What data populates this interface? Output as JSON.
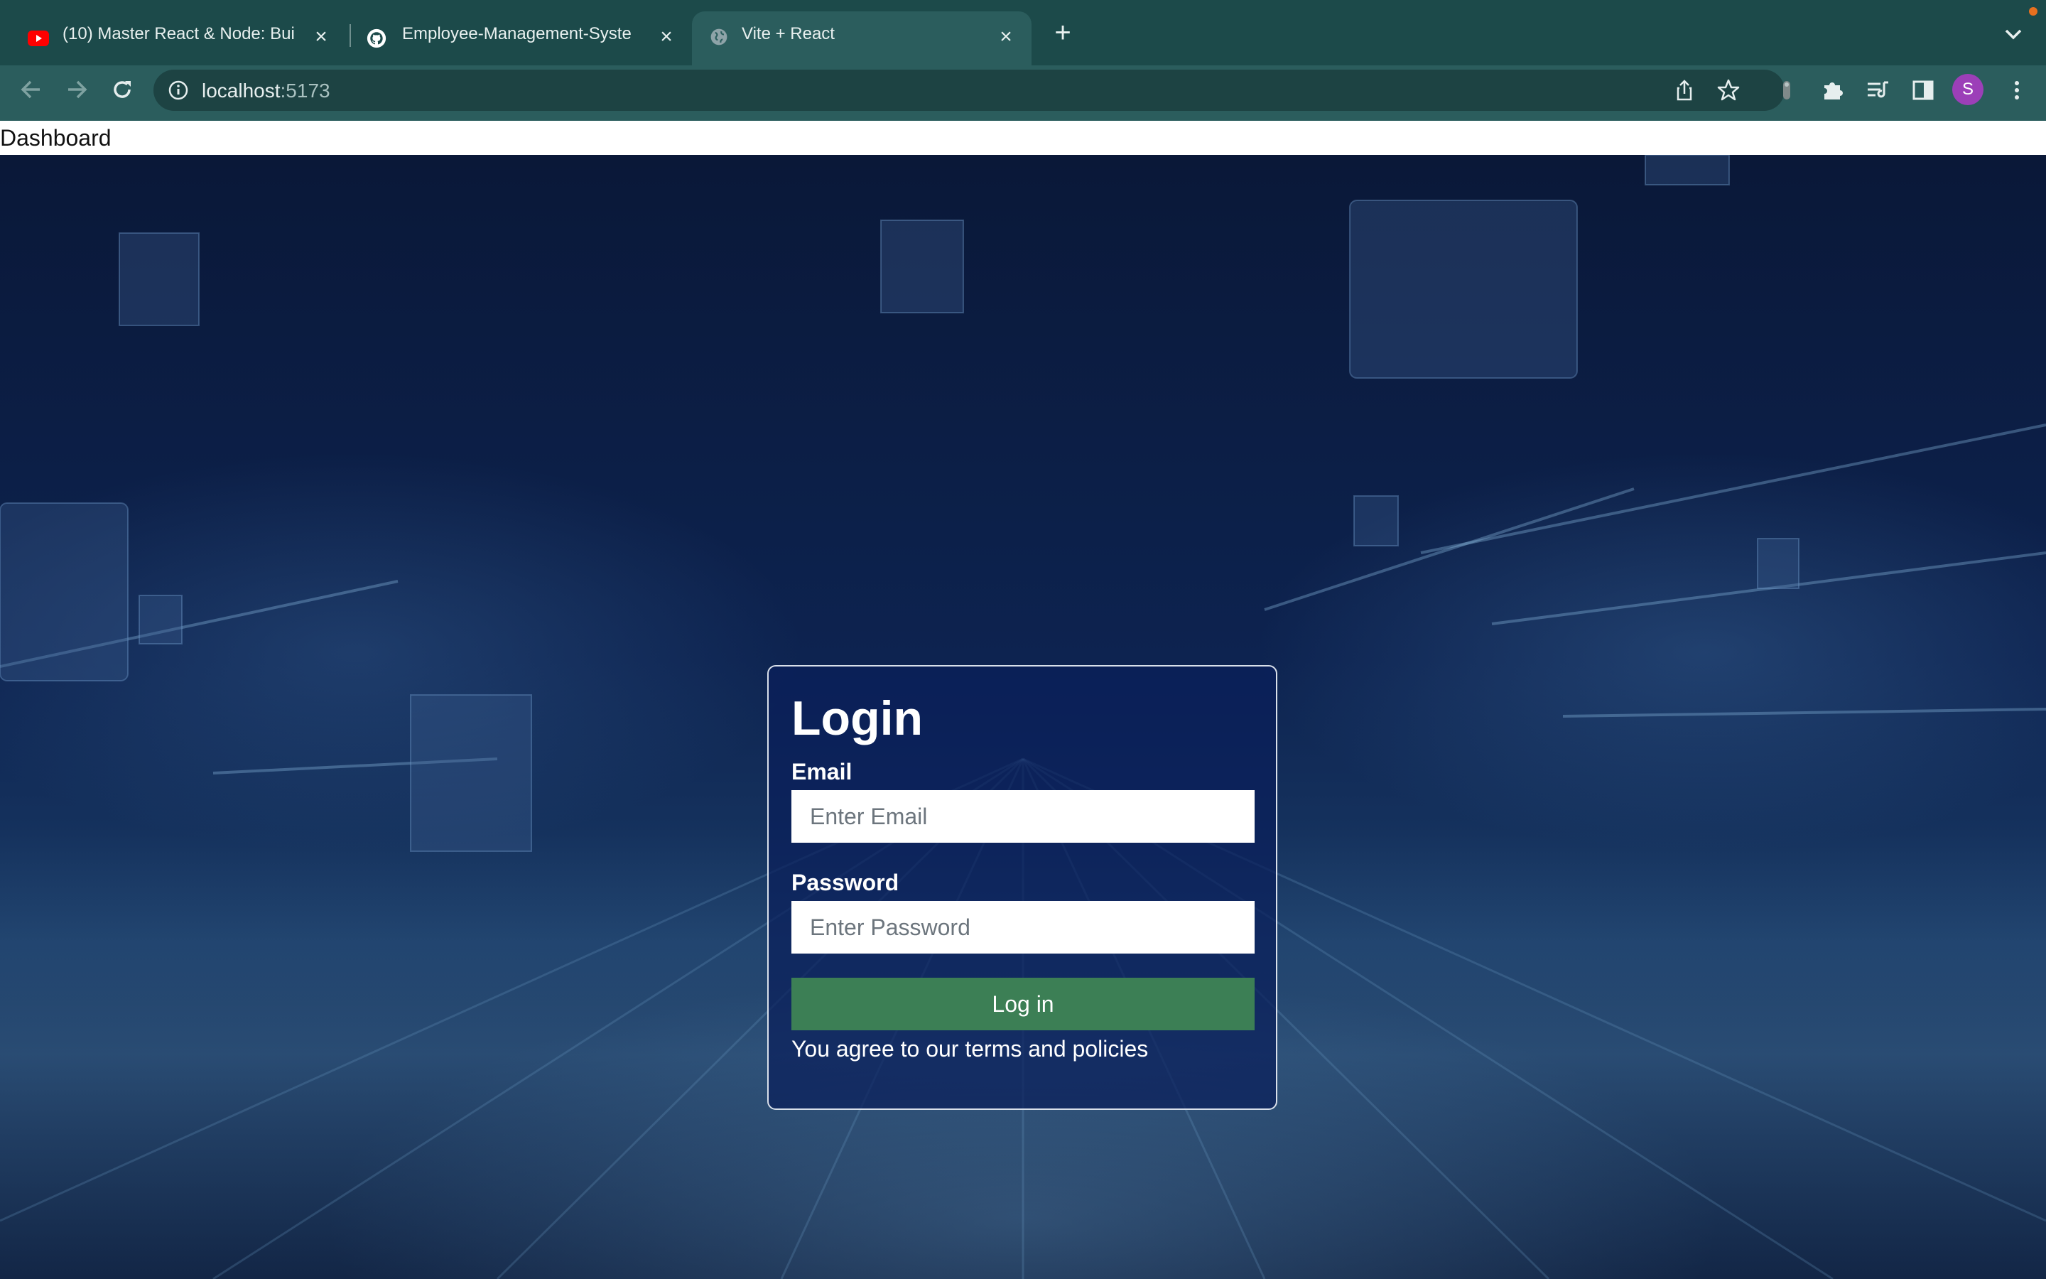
{
  "browser": {
    "tabs": [
      {
        "title": "(10) Master React & Node: Bui",
        "icon": "youtube-icon",
        "active": false
      },
      {
        "title": "Employee-Management-Syste",
        "icon": "github-icon",
        "active": false
      },
      {
        "title": "Vite + React",
        "icon": "globe-icon",
        "active": true
      }
    ],
    "url_host": "localhost",
    "url_port": ":5173",
    "profile_initial": "S",
    "colors": {
      "tabbar": "#1c4a4a",
      "toolbar": "#2b5d5d",
      "avatar": "#9c3fb8"
    }
  },
  "navbar": {
    "brand": "Dashboard"
  },
  "login": {
    "title": "Login",
    "email_label": "Email",
    "email_placeholder": "Enter Email",
    "password_label": "Password",
    "password_placeholder": "Enter Password",
    "submit_label": "Log in",
    "terms_text": "You agree to our terms and policies",
    "button_color": "#3c7f55"
  }
}
